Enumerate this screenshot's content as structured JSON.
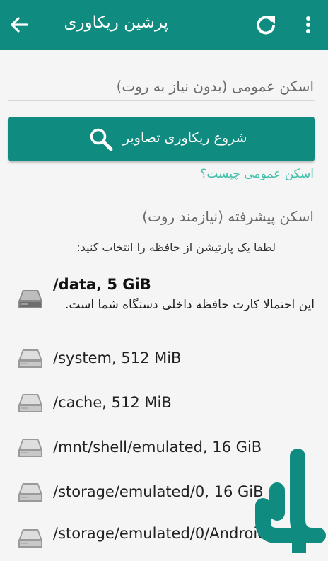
{
  "appbar": {
    "title": "پرشین ریکاوری",
    "back_icon": "arrow-back-icon",
    "refresh_icon": "refresh-icon",
    "more_icon": "more-vert-icon",
    "color": "#0f8b80"
  },
  "general_scan": {
    "heading": "اسکن عمومی (بدون نیاز به روت)",
    "button_label": "شروع ریکاوری تصاویر",
    "button_icon": "search-icon",
    "link": "اسکن عمومی چیست؟"
  },
  "advanced_scan": {
    "heading": "اسکن پیشرفته (نیازمند روت)",
    "hint": "لطفا یک پارتیشن از حافظه را انتخاب کنید:"
  },
  "partitions": [
    {
      "name": "/data, 5 GiB",
      "description": "این احتمالا کارت حافظه داخلی دستگاه شما است.",
      "icon": "hard-disk-icon"
    },
    {
      "name": "/system, 512 MiB",
      "icon": "hard-disk-icon"
    },
    {
      "name": "/cache, 512 MiB",
      "icon": "hard-disk-icon"
    },
    {
      "name": "/mnt/shell/emulated, 16 GiB",
      "icon": "hard-disk-icon"
    },
    {
      "name": "/storage/emulated/0, 16 GiB",
      "icon": "hard-disk-icon"
    },
    {
      "name": "/storage/emulated/0/Android/",
      "icon": "hard-disk-icon"
    }
  ]
}
